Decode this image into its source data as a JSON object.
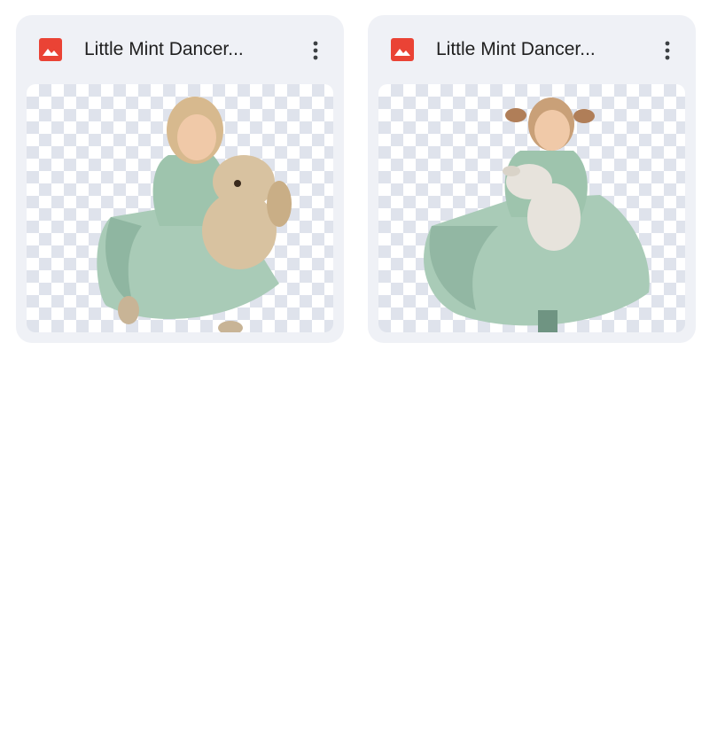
{
  "files": [
    {
      "name": "Little Mint Dancer...",
      "type_icon": "image-file-icon",
      "menu_icon": "more-vert-icon"
    },
    {
      "name": "Little Mint Dancer...",
      "type_icon": "image-file-icon",
      "menu_icon": "more-vert-icon"
    }
  ],
  "colors": {
    "card_bg": "#eff1f6",
    "image_icon": "#ea4335",
    "title_text": "#1f1f1f",
    "dress": "#a9cbb7",
    "dress_shadow": "#7fa893",
    "bear": "#d8c2a0",
    "bunny": "#e7e3dc"
  }
}
